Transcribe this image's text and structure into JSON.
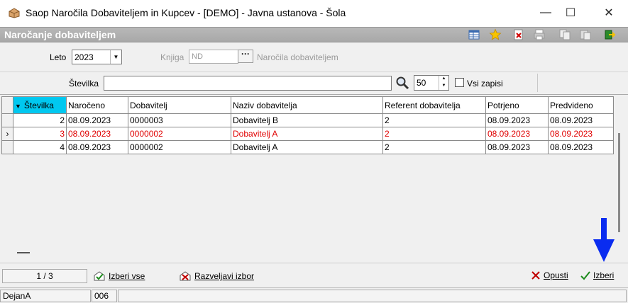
{
  "window": {
    "title": "Saop Naročila Dobaviteljem in Kupcev -  [DEMO] - Javna ustanova - Šola",
    "minimize": "—",
    "maximize": "☐",
    "close": "✕"
  },
  "header": {
    "title": "Naročanje dobaviteljem"
  },
  "filters": {
    "leto_label": "Leto",
    "leto_value": "2023",
    "knjiga_label": "Knjiga",
    "knjiga_value": "ND",
    "knjiga_button": "···",
    "knjiga_desc": "Naročila dobaviteljem",
    "stevilka_label": "Številka",
    "limit_value": "50",
    "vsi_zapisi_label": "Vsi zapisi"
  },
  "table": {
    "columns": [
      "Številka",
      "Naročeno",
      "Dobavitelj",
      "Naziv dobavitelja",
      "Referent dobavitelja",
      "Potrjeno",
      "Predvideno"
    ],
    "rows": [
      {
        "stevilka": "2",
        "naroceno": "08.09.2023",
        "dobavitelj": "0000003",
        "naziv": "Dobavitelj B",
        "referent": "2",
        "potrjeno": "08.09.2023",
        "predvideno": "08.09.2023",
        "indicator": ""
      },
      {
        "stevilka": "3",
        "naroceno": "08.09.2023",
        "dobavitelj": "0000002",
        "naziv": "Dobavitelj A",
        "referent": "2",
        "potrjeno": "08.09.2023",
        "predvideno": "08.09.2023",
        "indicator": "›"
      },
      {
        "stevilka": "4",
        "naroceno": "08.09.2023",
        "dobavitelj": "0000002",
        "naziv": "Dobavitelj A",
        "referent": "2",
        "potrjeno": "08.09.2023",
        "predvideno": "08.09.2023",
        "indicator": ""
      }
    ],
    "selected_row_color": "#e00000",
    "sorted_header_color": "#00c8f0"
  },
  "actions": {
    "page": "1 / 3",
    "izberi_vse": "Izberi vse",
    "razveljavi_izbor": "Razveljavi izbor",
    "opusti": "Opusti",
    "izberi": "Izberi"
  },
  "status": {
    "user": "DejanA",
    "code": "006"
  },
  "icons": [
    "app-icon",
    "table-icon",
    "star-icon",
    "delete-icon",
    "print-icon",
    "copy-icon",
    "paste-icon",
    "exit-icon",
    "search-icon",
    "select-all-icon",
    "undo-select-icon",
    "cancel-icon",
    "check-icon",
    "arrow-down-icon"
  ]
}
